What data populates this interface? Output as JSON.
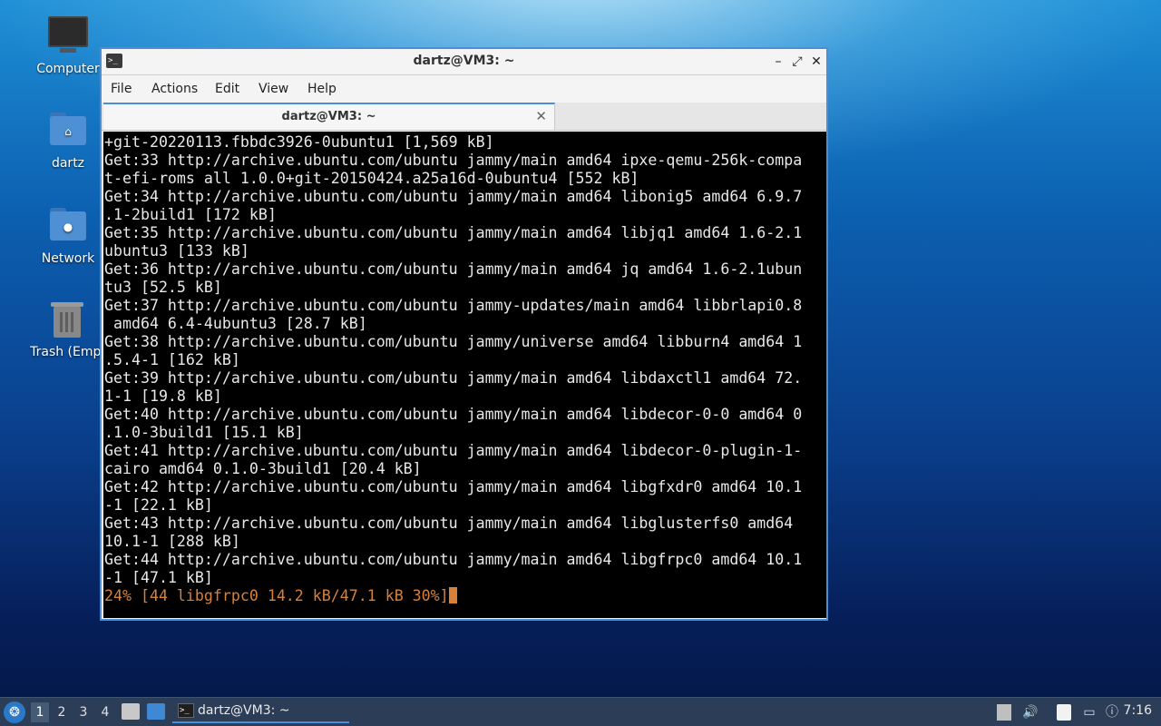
{
  "desktop": {
    "icons": [
      {
        "label": "Computer",
        "icon": "computer-icon"
      },
      {
        "label": "dartz",
        "icon": "home-folder-icon"
      },
      {
        "label": "Network",
        "icon": "network-folder-icon"
      },
      {
        "label": "Trash (Empt",
        "icon": "trash-icon"
      }
    ]
  },
  "window": {
    "title": "dartz@VM3: ~",
    "menu": [
      "File",
      "Actions",
      "Edit",
      "View",
      "Help"
    ],
    "tab_label": "dartz@VM3: ~",
    "border_color": "#4a90d9"
  },
  "terminal": {
    "lines": [
      "+git-20220113.fbbdc3926-0ubuntu1 [1,569 kB]",
      "Get:33 http://archive.ubuntu.com/ubuntu jammy/main amd64 ipxe-qemu-256k-compa",
      "t-efi-roms all 1.0.0+git-20150424.a25a16d-0ubuntu4 [552 kB]",
      "Get:34 http://archive.ubuntu.com/ubuntu jammy/main amd64 libonig5 amd64 6.9.7",
      ".1-2build1 [172 kB]",
      "Get:35 http://archive.ubuntu.com/ubuntu jammy/main amd64 libjq1 amd64 1.6-2.1",
      "ubuntu3 [133 kB]",
      "Get:36 http://archive.ubuntu.com/ubuntu jammy/main amd64 jq amd64 1.6-2.1ubun",
      "tu3 [52.5 kB]",
      "Get:37 http://archive.ubuntu.com/ubuntu jammy-updates/main amd64 libbrlapi0.8",
      " amd64 6.4-4ubuntu3 [28.7 kB]",
      "Get:38 http://archive.ubuntu.com/ubuntu jammy/universe amd64 libburn4 amd64 1",
      ".5.4-1 [162 kB]",
      "Get:39 http://archive.ubuntu.com/ubuntu jammy/main amd64 libdaxctl1 amd64 72.",
      "1-1 [19.8 kB]",
      "Get:40 http://archive.ubuntu.com/ubuntu jammy/main amd64 libdecor-0-0 amd64 0",
      ".1.0-3build1 [15.1 kB]",
      "Get:41 http://archive.ubuntu.com/ubuntu jammy/main amd64 libdecor-0-plugin-1-",
      "cairo amd64 0.1.0-3build1 [20.4 kB]",
      "Get:42 http://archive.ubuntu.com/ubuntu jammy/main amd64 libgfxdr0 amd64 10.1",
      "-1 [22.1 kB]",
      "Get:43 http://archive.ubuntu.com/ubuntu jammy/main amd64 libglusterfs0 amd64",
      "10.1-1 [288 kB]",
      "Get:44 http://archive.ubuntu.com/ubuntu jammy/main amd64 libgfrpc0 amd64 10.1",
      "-1 [47.1 kB]"
    ],
    "status_line": "24% [44 libgfrpc0 14.2 kB/47.1 kB 30%]",
    "status_color": "#d7803a"
  },
  "taskbar": {
    "workspaces": [
      "1",
      "2",
      "3",
      "4"
    ],
    "active_workspace": "1",
    "task_label": "dartz@VM3: ~",
    "clock": "7:16",
    "accent": "#4a90d9"
  }
}
